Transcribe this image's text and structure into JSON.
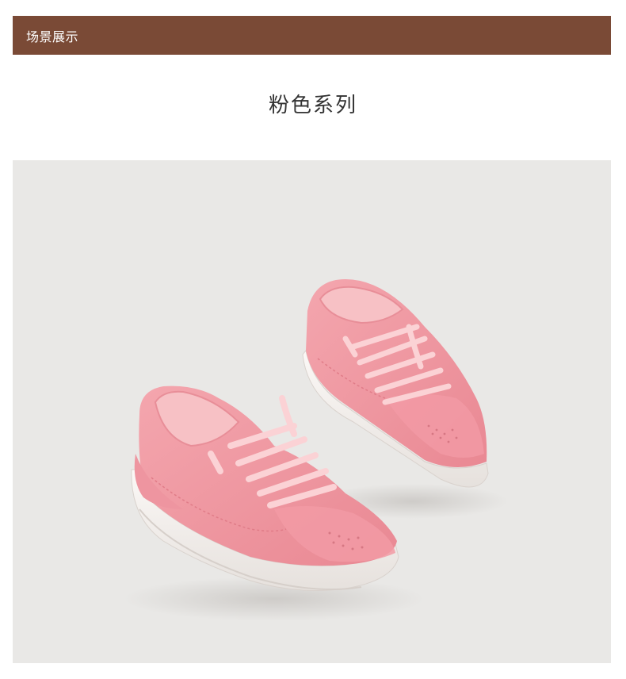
{
  "header": {
    "section_label": "场景展示",
    "background_color": "#7a4a36"
  },
  "section": {
    "title": "粉色系列"
  },
  "photo": {
    "background_color": "#e9e8e6",
    "subject": "pink-kids-sneakers-pair"
  }
}
